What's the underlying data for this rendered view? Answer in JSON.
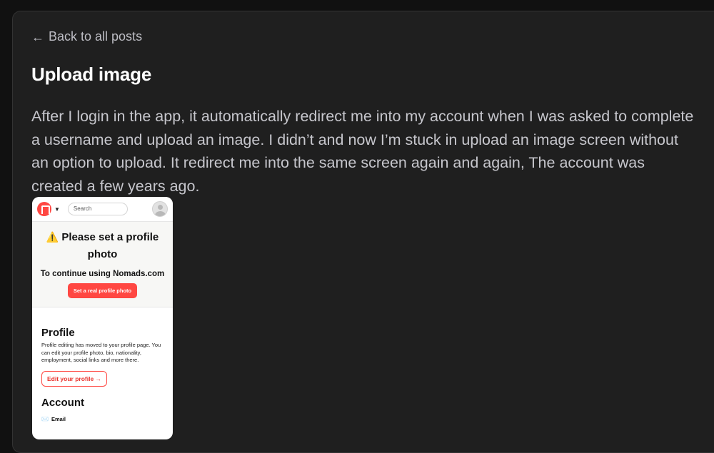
{
  "nav": {
    "back_arrow": "←",
    "back_label": "Back to all posts"
  },
  "post": {
    "title": "Upload image",
    "body": "After I login in the app, it automatically redirect me into my account when I was asked to complete a username and upload an image. I didn’t and now I’m stuck in upload an image screen without an option to upload. It redirect me into the same screen again and again, The account was created a few years ago."
  },
  "screenshot": {
    "search_placeholder": "Search",
    "warning_icon": "⚠️",
    "notice_title": "Please set a profile photo",
    "notice_sub": "To continue using Nomads.com",
    "notice_button": "Set a real profile photo",
    "profile_heading": "Profile",
    "profile_text": "Profile editing has moved to your profile page. You can edit your profile photo, bio, nationality, employment, social links and more there.",
    "edit_button": "Edit your profile →",
    "account_heading": "Account",
    "email_icon": "✉️",
    "email_label": "Email"
  },
  "colors": {
    "background": "#111111",
    "panel": "#1f1f1f",
    "accent": "#ff4742"
  }
}
